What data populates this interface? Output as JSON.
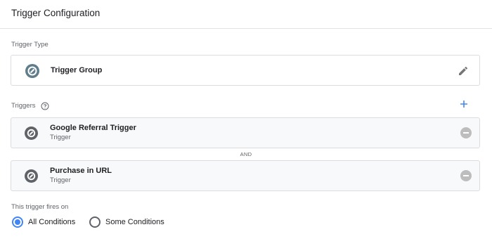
{
  "header": {
    "title": "Trigger Configuration"
  },
  "trigger_type": {
    "label": "Trigger Type",
    "value": "Trigger Group",
    "icon": "trigger-group-icon",
    "edit_icon": "edit-pencil-icon"
  },
  "triggers": {
    "label": "Triggers",
    "help_icon": "help-icon",
    "add_icon": "add-icon",
    "items": [
      {
        "name": "Google Referral Trigger",
        "type": "Trigger",
        "icon": "trigger-icon"
      },
      {
        "name": "Purchase in URL",
        "type": "Trigger",
        "icon": "trigger-icon"
      }
    ],
    "separator": "AND"
  },
  "fires_on": {
    "label": "This trigger fires on",
    "options": [
      {
        "label": "All Conditions",
        "selected": true
      },
      {
        "label": "Some Conditions",
        "selected": false
      }
    ]
  },
  "colors": {
    "accent": "#4285f4",
    "trigger_group_icon": "#607d8b",
    "trigger_icon": "#5f6368",
    "remove_icon": "#bdbdbd",
    "border": "#dadce0",
    "row_background": "#f8f9fa"
  }
}
